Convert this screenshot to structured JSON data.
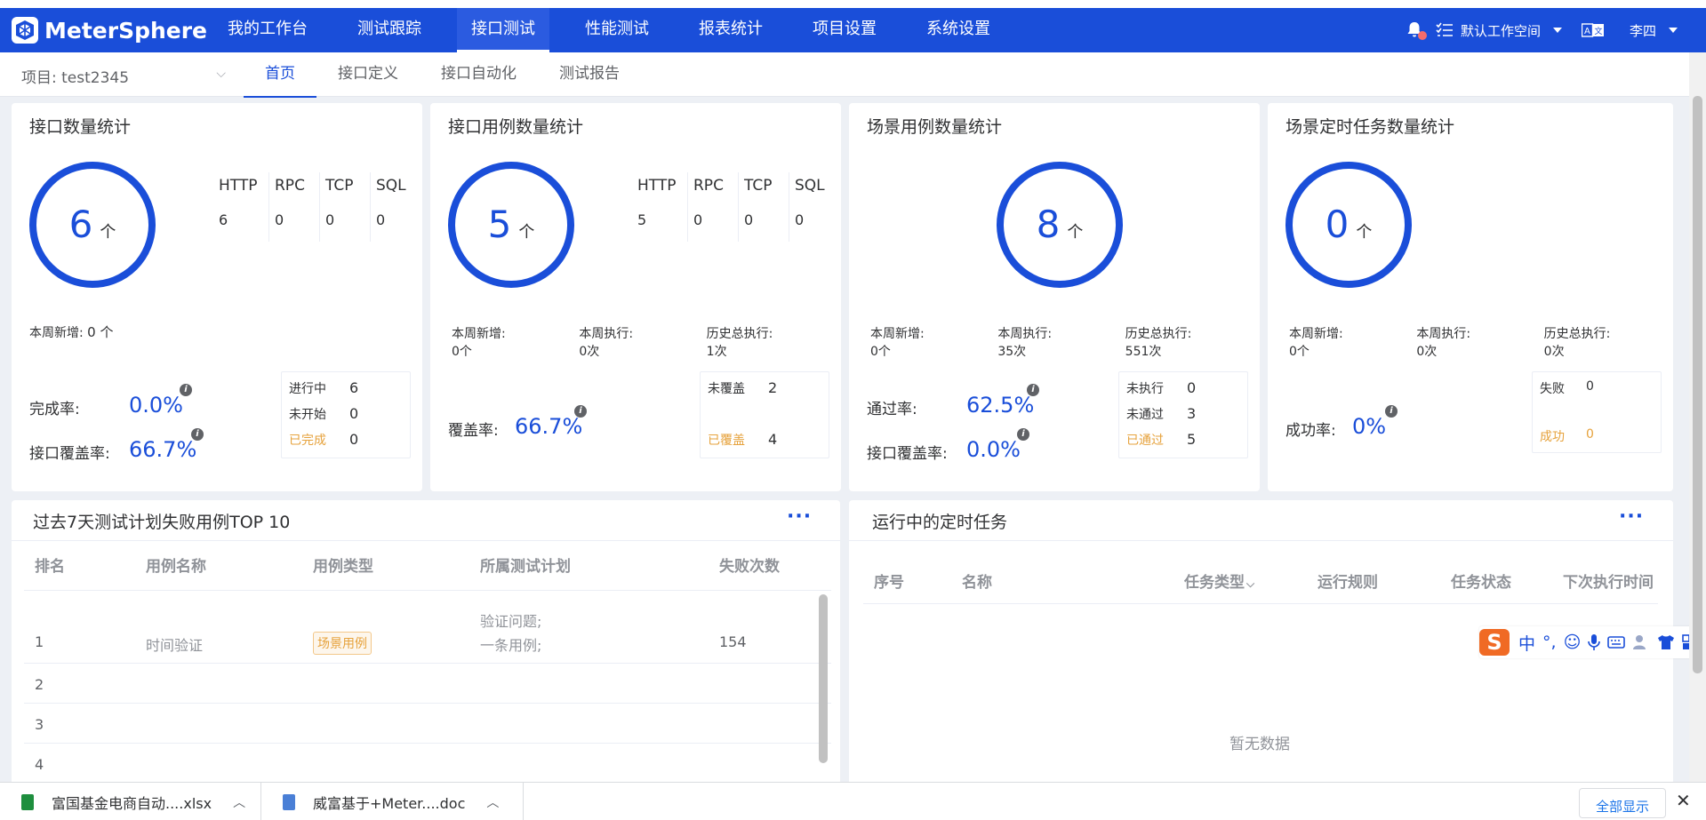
{
  "header": {
    "logo": "MeterSphere",
    "nav": [
      {
        "label": "我的工作台",
        "active": false
      },
      {
        "label": "测试跟踪",
        "active": false
      },
      {
        "label": "接口测试",
        "active": true
      },
      {
        "label": "性能测试",
        "active": false
      },
      {
        "label": "报表统计",
        "active": false
      },
      {
        "label": "项目设置",
        "active": false
      },
      {
        "label": "系统设置",
        "active": false
      }
    ],
    "workspace": "默认工作空间",
    "user": "李四"
  },
  "subnav": {
    "project": "项目: test2345",
    "tabs": [
      {
        "label": "首页",
        "active": true
      },
      {
        "label": "接口定义",
        "active": false
      },
      {
        "label": "接口自动化",
        "active": false
      },
      {
        "label": "测试报告",
        "active": false
      }
    ]
  },
  "cards": {
    "api": {
      "title": "接口数量统计",
      "count": "6",
      "unit": "个",
      "protocols": [
        {
          "name": "HTTP",
          "value": "6"
        },
        {
          "name": "RPC",
          "value": "0"
        },
        {
          "name": "TCP",
          "value": "0"
        },
        {
          "name": "SQL",
          "value": "0"
        }
      ],
      "week_label": "本周新增:",
      "week_value": "0 个",
      "rate1_label": "完成率:",
      "rate1_value": "0.0%",
      "rate2_label": "接口覆盖率:",
      "rate2_value": "66.7%",
      "status": [
        {
          "label": "进行中",
          "value": "6"
        },
        {
          "label": "未开始",
          "value": "0"
        },
        {
          "label": "已完成",
          "value": "0"
        }
      ]
    },
    "case": {
      "title": "接口用例数量统计",
      "count": "5",
      "unit": "个",
      "protocols": [
        {
          "name": "HTTP",
          "value": "5"
        },
        {
          "name": "RPC",
          "value": "0"
        },
        {
          "name": "TCP",
          "value": "0"
        },
        {
          "name": "SQL",
          "value": "0"
        }
      ],
      "stats": [
        {
          "label": "本周新增:",
          "value": "0个"
        },
        {
          "label": "本周执行:",
          "value": "0次"
        },
        {
          "label": "历史总执行:",
          "value": "1次"
        }
      ],
      "rate_label": "覆盖率:",
      "rate_value": "66.7%",
      "status": [
        {
          "label": "未覆盖",
          "value": "2"
        },
        {
          "label": "已覆盖",
          "value": "4"
        }
      ]
    },
    "scenario": {
      "title": "场景用例数量统计",
      "count": "8",
      "unit": "个",
      "stats": [
        {
          "label": "本周新增:",
          "value": "0个"
        },
        {
          "label": "本周执行:",
          "value": "35次"
        },
        {
          "label": "历史总执行:",
          "value": "551次"
        }
      ],
      "rate1_label": "通过率:",
      "rate1_value": "62.5%",
      "rate2_label": "接口覆盖率:",
      "rate2_value": "0.0%",
      "status": [
        {
          "label": "未执行",
          "value": "0"
        },
        {
          "label": "未通过",
          "value": "3"
        },
        {
          "label": "已通过",
          "value": "5"
        }
      ]
    },
    "schedule": {
      "title": "场景定时任务数量统计",
      "count": "0",
      "unit": "个",
      "stats": [
        {
          "label": "本周新增:",
          "value": "0个"
        },
        {
          "label": "本周执行:",
          "value": "0次"
        },
        {
          "label": "历史总执行:",
          "value": "0次"
        }
      ],
      "rate_label": "成功率:",
      "rate_value": "0%",
      "status": [
        {
          "label": "失败",
          "value": "0"
        },
        {
          "label": "成功",
          "value": "0"
        }
      ]
    }
  },
  "failTop": {
    "title": "过去7天测试计划失败用例TOP 10",
    "more": "···",
    "columns": [
      "排名",
      "用例名称",
      "用例类型",
      "所属测试计划",
      "失败次数"
    ],
    "rows": [
      {
        "rank": "1",
        "name": "时间验证",
        "type": "场景用例",
        "plan1": "验证问题;",
        "plan2": "一条用例;",
        "fails": "154"
      },
      {
        "rank": "2"
      },
      {
        "rank": "3"
      },
      {
        "rank": "4"
      }
    ]
  },
  "running": {
    "title": "运行中的定时任务",
    "more": "···",
    "columns": [
      "序号",
      "名称",
      "任务类型",
      "运行规则",
      "任务状态",
      "下次执行时间"
    ],
    "empty": "暂无数据"
  },
  "ime": {
    "lang": "中",
    "punct": "°,"
  },
  "downloads": {
    "items": [
      {
        "name": "富国基金电商自动....xlsx",
        "color": "#1e8e3e"
      },
      {
        "name": "威富基于+Meter....doc",
        "color": "#4a7fd6"
      }
    ],
    "show_all": "全部显示",
    "close": "✕"
  }
}
